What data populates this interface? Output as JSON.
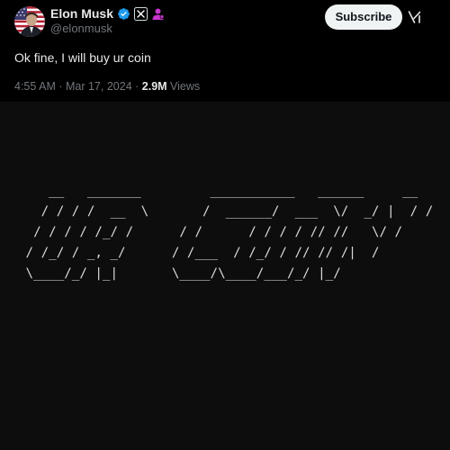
{
  "author": {
    "display_name": "Elon Musk",
    "handle": "@elonmusk",
    "avatar_icon": "avatar-photo",
    "badges": [
      "verified-badge-icon",
      "x-affiliate-icon",
      "parody-person-icon"
    ]
  },
  "actions": {
    "subscribe_label": "Subscribe",
    "grok_icon": "grok-icon"
  },
  "tweet": {
    "text": "Ok fine, I will buy ur coin",
    "time": "4:55 AM",
    "separator": " · ",
    "date": "Mar 17, 2024",
    "views_count": "2.9M",
    "views_label": " Views"
  },
  "media": {
    "ascii_art": "    __   _______         ___________   ______     __ \n   / / / /  __  \\       /  ______/  ___  \\/  _/ |  / /\n  / / / / /_/ /      / /      / / / / // //   \\/ / \n / /_/ / _, _/      / /___  / /_/ / // // /|  /  \n \\____/_/ |_|       \\____/\\____/___/_/ |_/   "
  },
  "colors": {
    "background": "#000000",
    "media_background": "#0d0d0d",
    "verified_blue": "#1d9bf0",
    "parody_purple": "#c936cc",
    "button_bg": "#eff3f4",
    "secondary_text": "#71767b",
    "primary_text": "#e7e9ea"
  }
}
